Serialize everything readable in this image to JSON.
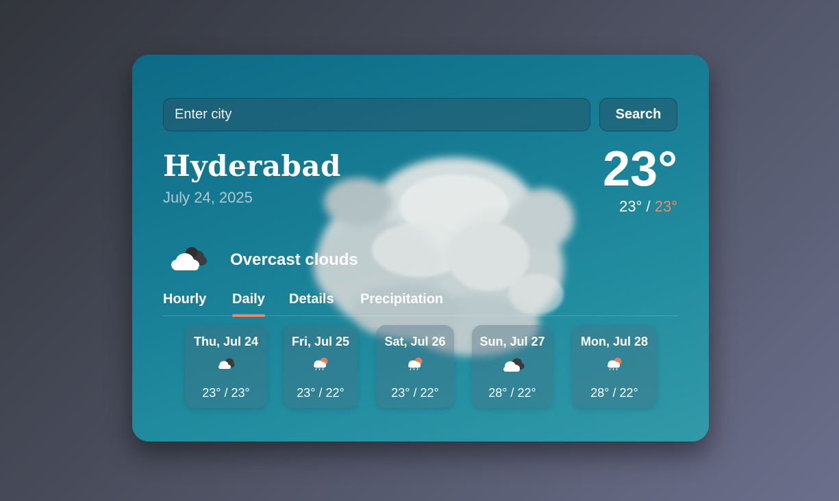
{
  "search": {
    "placeholder": "Enter city",
    "button_label": "Search"
  },
  "location": {
    "city": "Hyderabad",
    "date": "July 24, 2025"
  },
  "current": {
    "temperature": "23°",
    "low": "23°",
    "separator": " / ",
    "high": "23°",
    "high_color": "#ee8d67",
    "condition": "Overcast clouds",
    "condition_icon": "overcast-clouds-icon"
  },
  "tabs": [
    {
      "label": "Hourly",
      "active": false
    },
    {
      "label": "Daily",
      "active": true
    },
    {
      "label": "Details",
      "active": false
    },
    {
      "label": "Precipitation",
      "active": false
    }
  ],
  "accent_color": "#ee7d63",
  "forecast": [
    {
      "day": "Thu, Jul 24",
      "icon": "overcast-clouds-icon",
      "temps": "23° / 23°"
    },
    {
      "day": "Fri, Jul 25",
      "icon": "sun-rain-cloud-icon",
      "temps": "23° / 22°"
    },
    {
      "day": "Sat, Jul 26",
      "icon": "sun-rain-cloud-icon",
      "temps": "23° / 22°"
    },
    {
      "day": "Sun, Jul 27",
      "icon": "overcast-clouds-icon",
      "temps": "28° / 22°"
    },
    {
      "day": "Mon, Jul 28",
      "icon": "sun-rain-cloud-icon",
      "temps": "28° / 22°"
    }
  ]
}
